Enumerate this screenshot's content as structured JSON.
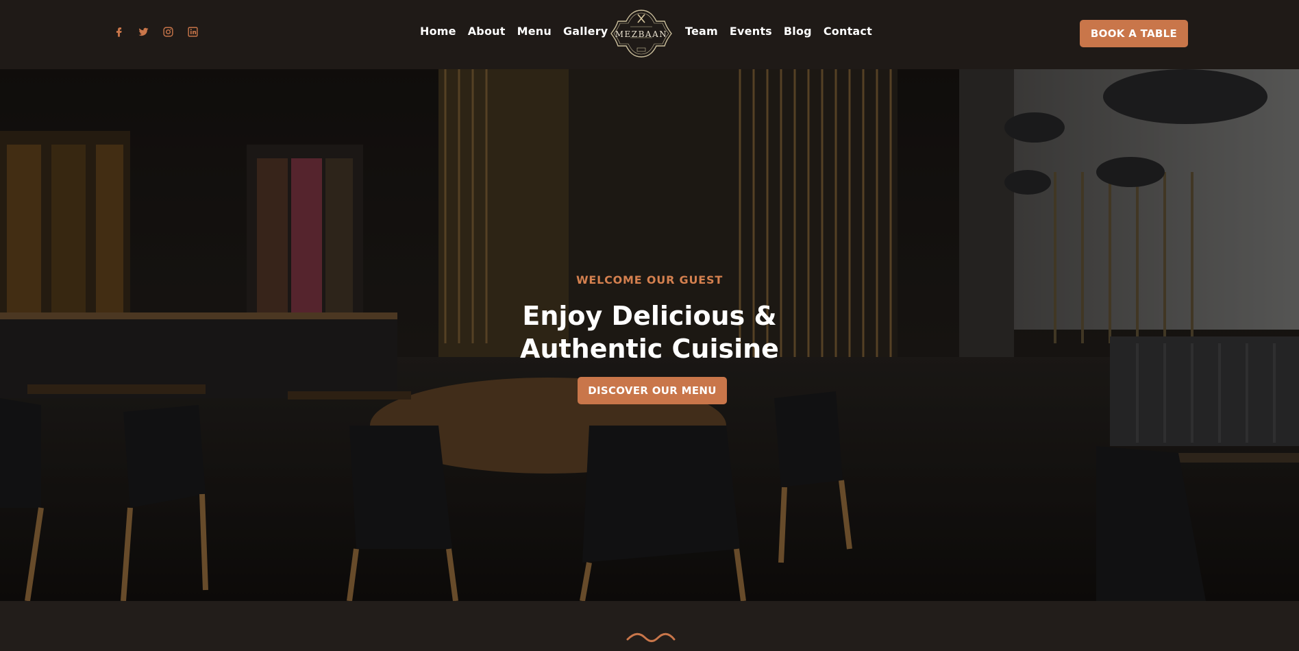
{
  "header": {
    "socials": [
      {
        "icon": "facebook-icon"
      },
      {
        "icon": "twitter-icon"
      },
      {
        "icon": "instagram-icon"
      },
      {
        "icon": "linkedin-icon"
      }
    ],
    "nav_left": [
      "Home",
      "About",
      "Menu",
      "Gallery"
    ],
    "nav_right": [
      "Team",
      "Events",
      "Blog",
      "Contact"
    ],
    "logo": {
      "name": "Mezbaan"
    },
    "book_button": "BOOK A TABLE"
  },
  "hero": {
    "subtitle": "WELCOME OUR GUEST",
    "title_line1": "Enjoy Delicious &",
    "title_line2": "Authentic Cuisine",
    "button": "DISCOVER OUR MENU"
  },
  "colors": {
    "accent": "#c9764a",
    "header_bg": "#1f1a17",
    "subtitle": "#d4804f"
  }
}
